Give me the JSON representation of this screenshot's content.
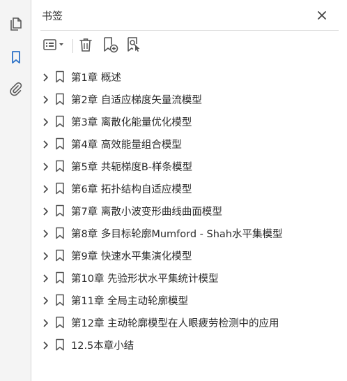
{
  "panel": {
    "title": "书签",
    "close_icon": "close-icon"
  },
  "rail": {
    "items": [
      {
        "icon": "pages-icon"
      },
      {
        "icon": "bookmark-icon",
        "active": true
      },
      {
        "icon": "attachment-icon"
      }
    ],
    "accent": "#2c72c7"
  },
  "toolbar": {
    "options_icon": "list-options-icon",
    "delete_icon": "trash-icon",
    "new_icon": "new-bookmark-icon",
    "find_icon": "find-bookmark-icon"
  },
  "bookmarks": [
    {
      "label": "第1章 概述"
    },
    {
      "label": "第2章 自适应梯度矢量流模型"
    },
    {
      "label": "第3章 离散化能量优化模型"
    },
    {
      "label": "第4章 高效能量组合模型"
    },
    {
      "label": "第5章 共轭梯度B-样条模型"
    },
    {
      "label": "第6章 拓扑结构自适应模型"
    },
    {
      "label": "第7章 离散小波变形曲线曲面模型"
    },
    {
      "label": "第8章 多目标轮廓Mumford - Shah水平集模型"
    },
    {
      "label": "第9章 快速水平集演化模型"
    },
    {
      "label": "第10章 先验形状水平集统计模型"
    },
    {
      "label": "第11章 全局主动轮廓模型"
    },
    {
      "label": "第12章 主动轮廓模型在人眼疲劳检测中的应用"
    },
    {
      "label": "12.5本章小结"
    }
  ]
}
